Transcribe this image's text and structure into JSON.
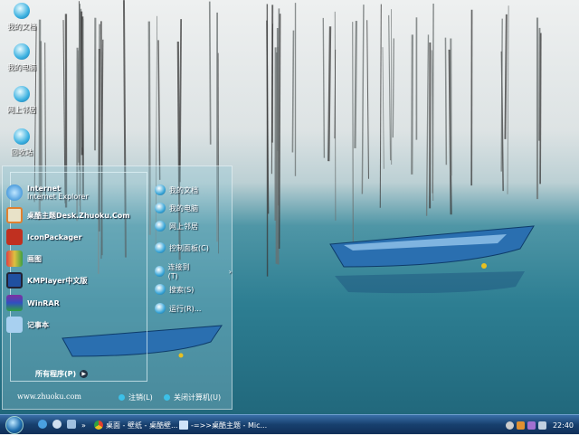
{
  "desktop_icons": [
    {
      "label": "我的文档"
    },
    {
      "label": "我的电脑"
    },
    {
      "label": "网上邻居"
    },
    {
      "label": "回收站"
    }
  ],
  "start_menu": {
    "pinned": [
      {
        "title": "Internet",
        "subtitle": "Internet Explorer",
        "icon": "ie-icon"
      }
    ],
    "programs": [
      {
        "label": "桌酷主题Desk.Zhuoku.Com",
        "icon": "theme-icon"
      },
      {
        "label": "IconPackager",
        "icon": "iconpackager-icon"
      },
      {
        "label": "画图",
        "icon": "paint-icon"
      },
      {
        "label": "KMPlayer中文版",
        "icon": "kmplayer-icon"
      },
      {
        "label": "WinRAR",
        "icon": "winrar-icon"
      },
      {
        "label": "记事本",
        "icon": "notepad-icon"
      }
    ],
    "all_programs": "所有程序(P)",
    "right": [
      {
        "label": "我的文档"
      },
      {
        "label": "我的电脑"
      },
      {
        "label": "网上邻居"
      },
      {
        "label": "控制面板(C)"
      },
      {
        "label": "连接到(T)"
      },
      {
        "label": "搜索(S)"
      },
      {
        "label": "运行(R)..."
      }
    ],
    "website": "www.zhuoku.com",
    "logoff": "注销(L)",
    "shutdown": "关闭计算机(U)"
  },
  "taskbar": {
    "tasks": [
      {
        "label": "桌面 - 壁纸 - 桌酷壁..."
      },
      {
        "label": "-=>>桌酷主题 - Mic..."
      }
    ],
    "overflow": "»",
    "clock": "22:40"
  }
}
